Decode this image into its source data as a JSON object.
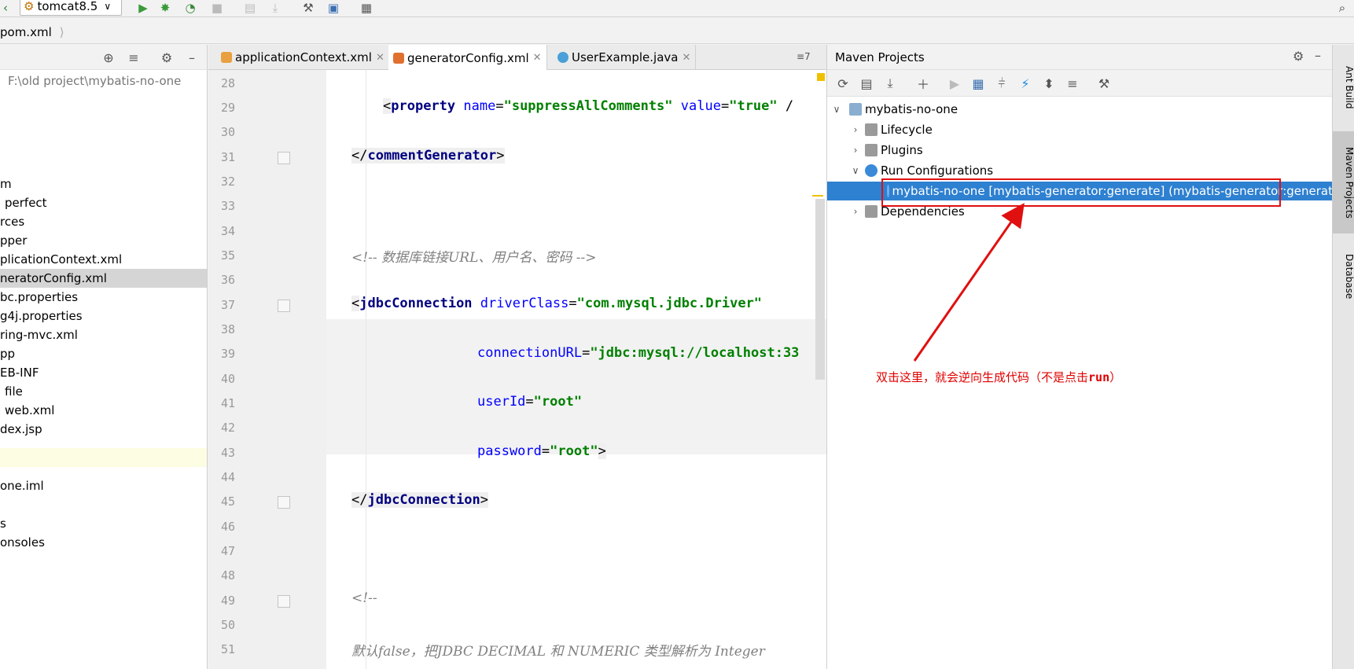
{
  "toolbar": {
    "run_config": "tomcat8.5"
  },
  "breadcrumb": {
    "file": "pom.xml"
  },
  "project": {
    "path": "F:\\old project\\mybatis-no-one",
    "items": [
      "m",
      "perfect",
      "rces",
      "pper",
      "plicationContext.xml",
      "neratorConfig.xml",
      "bc.properties",
      "g4j.properties",
      "ring-mvc.xml",
      "pp",
      "EB-INF",
      "file",
      "web.xml",
      "dex.jsp",
      "one.iml",
      "s",
      "onsoles"
    ]
  },
  "editor": {
    "tabs": [
      {
        "label": "applicationContext.xml"
      },
      {
        "label": "generatorConfig.xml"
      },
      {
        "label": "UserExample.java"
      }
    ],
    "tab_overflow": "≡7",
    "line_numbers": [
      "28",
      "29",
      "30",
      "31",
      "32",
      "33",
      "34",
      "35",
      "36",
      "37",
      "38",
      "39",
      "40",
      "41",
      "42",
      "43",
      "44",
      "45",
      "46",
      "47",
      "48",
      "49",
      "50",
      "51"
    ],
    "code": {
      "l29_tag": "property",
      "l29_attr1": "name",
      "l29_val1": "\"suppressAllComments\"",
      "l29_attr2": "value",
      "l29_val2": "\"true\"",
      "l29_tail": " /",
      "l31_tag": "commentGenerator",
      "l35_comment": "<!-- 数据库链接URL、用户名、密码 -->",
      "l37_tag": "jdbcConnection",
      "l37_attr": "driverClass",
      "l37_val": "\"com.mysql.jdbc.Driver\"",
      "l39_attr": "connectionURL",
      "l39_val": "\"jdbc:mysql://localhost:33",
      "l41_attr": "userId",
      "l41_val": "\"root\"",
      "l43_attr": "password",
      "l43_val": "\"root\"",
      "l45_tag": "jdbcConnection",
      "l49_comment": "<!--",
      "l51_comment": "默认false，把JDBC DECIMAL 和 NUMERIC 类型解析为 Integer"
    }
  },
  "maven": {
    "title": "Maven Projects",
    "tree": {
      "root": "mybatis-no-one",
      "lifecycle": "Lifecycle",
      "plugins": "Plugins",
      "run_configs": "Run Configurations",
      "run_item": "mybatis-no-one [mybatis-generator:generate] (mybatis-generator:generat",
      "dependencies": "Dependencies"
    }
  },
  "stripe": {
    "ant": "Ant Build",
    "maven": "Maven Projects",
    "database": "Database"
  },
  "annotation": {
    "text_main": "双击这里，就会逆向生成代码（不是点击",
    "text_run": "run",
    "text_end": "）",
    "color": "#e00000"
  }
}
